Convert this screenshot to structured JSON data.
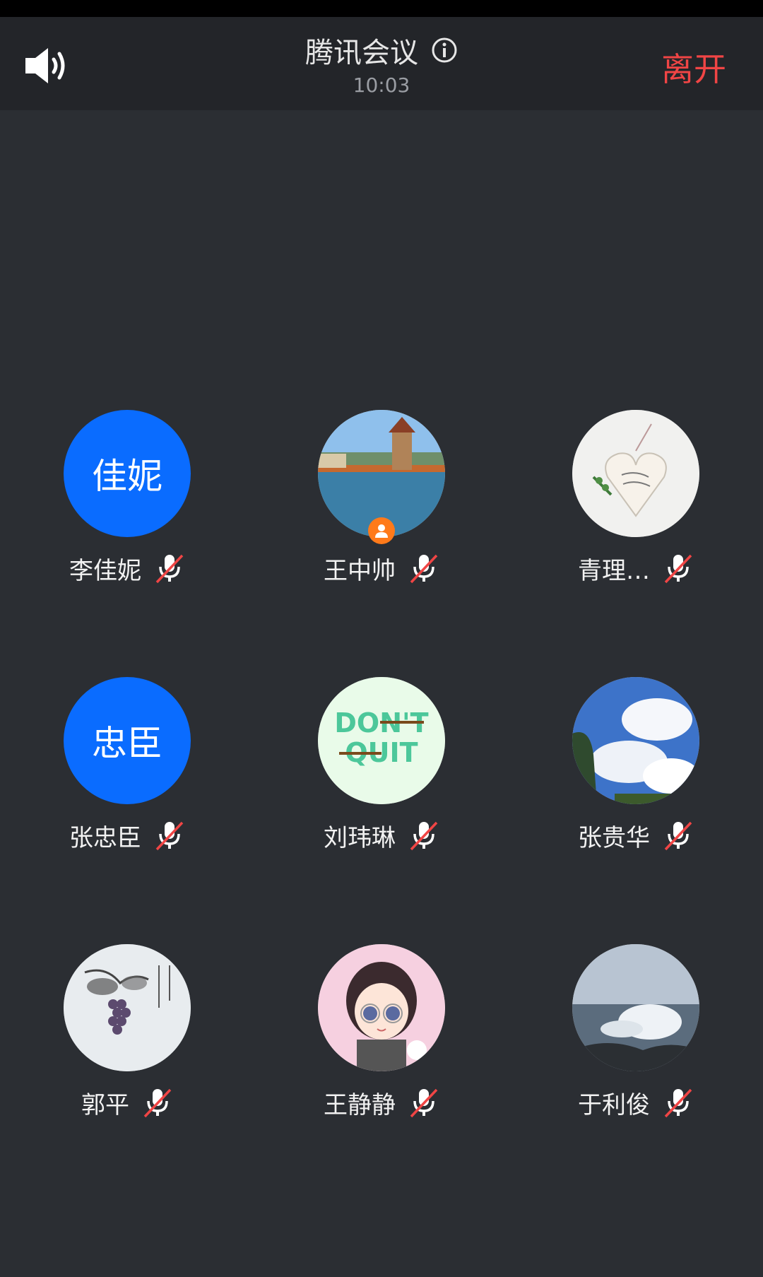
{
  "header": {
    "title": "腾讯会议",
    "time": "10:03",
    "leave_label": "离开"
  },
  "icons": {
    "speaker": "speaker-icon",
    "info": "info-icon",
    "mic_muted": "mic-muted-icon",
    "host": "host-badge-icon"
  },
  "colors": {
    "accent": "#0a6cff",
    "danger": "#f04545",
    "host": "#ff7a1a",
    "background": "#2b2e33"
  },
  "participants": [
    {
      "name": "李佳妮",
      "avatar_text": "佳妮",
      "avatar": "initials",
      "muted": true
    },
    {
      "name": "王中帅",
      "avatar": "photo-lake-tower",
      "muted": true,
      "host": true
    },
    {
      "name": "青理…",
      "avatar": "photo-heart-card",
      "muted": true
    },
    {
      "name": "张忠臣",
      "avatar_text": "忠臣",
      "avatar": "initials",
      "muted": true
    },
    {
      "name": "刘玮琳",
      "avatar": "photo-dont-quit",
      "muted": true
    },
    {
      "name": "张贵华",
      "avatar": "photo-sky-clouds",
      "muted": true
    },
    {
      "name": "郭平",
      "avatar": "photo-ink-grapes",
      "muted": true
    },
    {
      "name": "王静静",
      "avatar": "photo-cartoon-girl",
      "muted": true
    },
    {
      "name": "于利俊",
      "avatar": "photo-sea-wave",
      "muted": true
    }
  ],
  "avatar_art": {
    "dont_quit_line1": "DON'T",
    "dont_quit_line2": "QUIT"
  }
}
